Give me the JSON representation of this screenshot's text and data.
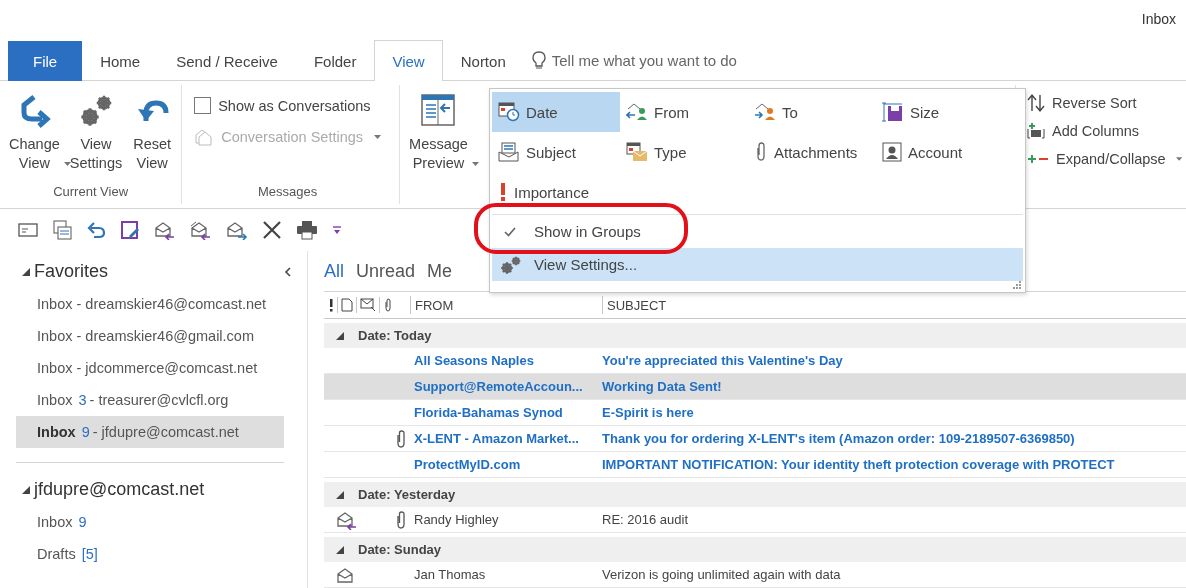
{
  "window": {
    "title": "Inbox"
  },
  "tabs": [
    {
      "label": "File",
      "kind": "file",
      "selected": false
    },
    {
      "label": "Home",
      "kind": "tab",
      "selected": false
    },
    {
      "label": "Send / Receive",
      "kind": "tab",
      "selected": false
    },
    {
      "label": "Folder",
      "kind": "tab",
      "selected": false
    },
    {
      "label": "View",
      "kind": "tab",
      "selected": true
    },
    {
      "label": "Norton",
      "kind": "tab",
      "selected": false
    }
  ],
  "tell_me": {
    "placeholder": "Tell me what you want to do"
  },
  "ribbon": {
    "current_view": {
      "label": "Current View",
      "buttons": [
        {
          "label": "Change View",
          "kind": "change",
          "dropdown": true
        },
        {
          "label": "View Settings",
          "kind": "settings",
          "dropdown": false
        },
        {
          "label": "Reset View",
          "kind": "reset",
          "dropdown": false
        }
      ]
    },
    "messages": {
      "label": "Messages",
      "show_as_conversations": {
        "label": "Show as Conversations",
        "checked": false
      },
      "conversation_settings": {
        "label": "Conversation Settings",
        "disabled": true,
        "dropdown": true
      }
    },
    "message_preview": {
      "label": "Message Preview",
      "dropdown": true
    },
    "arrangement": [
      {
        "label": "Reverse Sort",
        "kind": "reverse",
        "dropdown": false
      },
      {
        "label": "Add Columns",
        "kind": "columns",
        "dropdown": false
      },
      {
        "label": "Expand/Collapse",
        "kind": "expand",
        "dropdown": true
      }
    ]
  },
  "arrange_menu": {
    "items": [
      {
        "label": "Date",
        "kind": "date",
        "selected": true
      },
      {
        "label": "From",
        "kind": "from",
        "selected": false
      },
      {
        "label": "To",
        "kind": "to",
        "selected": false
      },
      {
        "label": "Size",
        "kind": "size",
        "selected": false
      },
      {
        "label": "Subject",
        "kind": "subject",
        "selected": false
      },
      {
        "label": "Type",
        "kind": "type",
        "selected": false
      },
      {
        "label": "Attachments",
        "kind": "attachments",
        "selected": false
      },
      {
        "label": "Account",
        "kind": "account",
        "selected": false
      },
      {
        "label": "Importance",
        "kind": "importance",
        "selected": false
      }
    ],
    "show_in_groups": {
      "label": "Show in Groups",
      "checked": true
    },
    "view_settings": {
      "label": "View Settings...",
      "highlighted": true
    }
  },
  "nav": {
    "favorites": {
      "label": "Favorites",
      "expanded": true,
      "items": [
        {
          "folder": "Inbox",
          "account": "- dreamskier46@comcast.net",
          "selected": false
        },
        {
          "folder": "Inbox",
          "account": "- dreamskier46@gmail.com",
          "selected": false
        },
        {
          "folder": "Inbox",
          "account": "- jdcommerce@comcast.net",
          "selected": false
        },
        {
          "folder": "Inbox",
          "count": "3",
          "account": "- treasurer@cvlcfl.org",
          "selected": false
        },
        {
          "folder": "Inbox",
          "count": "9",
          "account": "- jfdupre@comcast.net",
          "selected": true
        }
      ]
    },
    "account": {
      "label": "jfdupre@comcast.net",
      "expanded": true,
      "items": [
        {
          "folder": "Inbox",
          "count": "9",
          "selected": false
        },
        {
          "folder": "Drafts",
          "count": "[5]",
          "selected": false
        }
      ]
    }
  },
  "mail": {
    "filters": [
      {
        "label": "All",
        "selected": true
      },
      {
        "label": "Unread",
        "selected": false
      },
      {
        "label": "Me",
        "selected": false
      }
    ],
    "columns": [
      "FROM",
      "SUBJECT"
    ],
    "groups": [
      {
        "label": "Date: Today",
        "expanded": true,
        "rows": [
          {
            "from": "All Seasons Naples",
            "subject": "You're appreciated this Valentine's Day",
            "unread": true,
            "replied": false,
            "attachment": false,
            "selected": false
          },
          {
            "from": "Support@RemoteAccoun...",
            "subject": "Working Data Sent!",
            "unread": true,
            "replied": false,
            "attachment": false,
            "selected": true
          },
          {
            "from": "Florida-Bahamas Synod",
            "subject": "E-Spirit is here",
            "unread": true,
            "replied": false,
            "attachment": false,
            "selected": false
          },
          {
            "from": "X-LENT - Amazon Market...",
            "subject": "Thank you for ordering X-LENT's item (Amazon order: 109-2189507-6369850)",
            "unread": true,
            "replied": false,
            "attachment": true,
            "selected": false
          },
          {
            "from": "ProtectMyID.com",
            "subject": "IMPORTANT NOTIFICATION: Your identity theft protection coverage with PROTECT",
            "unread": true,
            "replied": false,
            "attachment": false,
            "selected": false
          }
        ]
      },
      {
        "label": "Date: Yesterday",
        "expanded": true,
        "rows": [
          {
            "from": "Randy Highley",
            "subject": "RE: 2016 audit",
            "unread": false,
            "replied": true,
            "attachment": true,
            "selected": false
          }
        ]
      },
      {
        "label": "Date: Sunday",
        "expanded": true,
        "rows": [
          {
            "from": "Jan Thomas",
            "subject": "Verizon is going unlimited again with data",
            "unread": false,
            "replied": false,
            "attachment": false,
            "selected": false
          }
        ]
      }
    ]
  }
}
